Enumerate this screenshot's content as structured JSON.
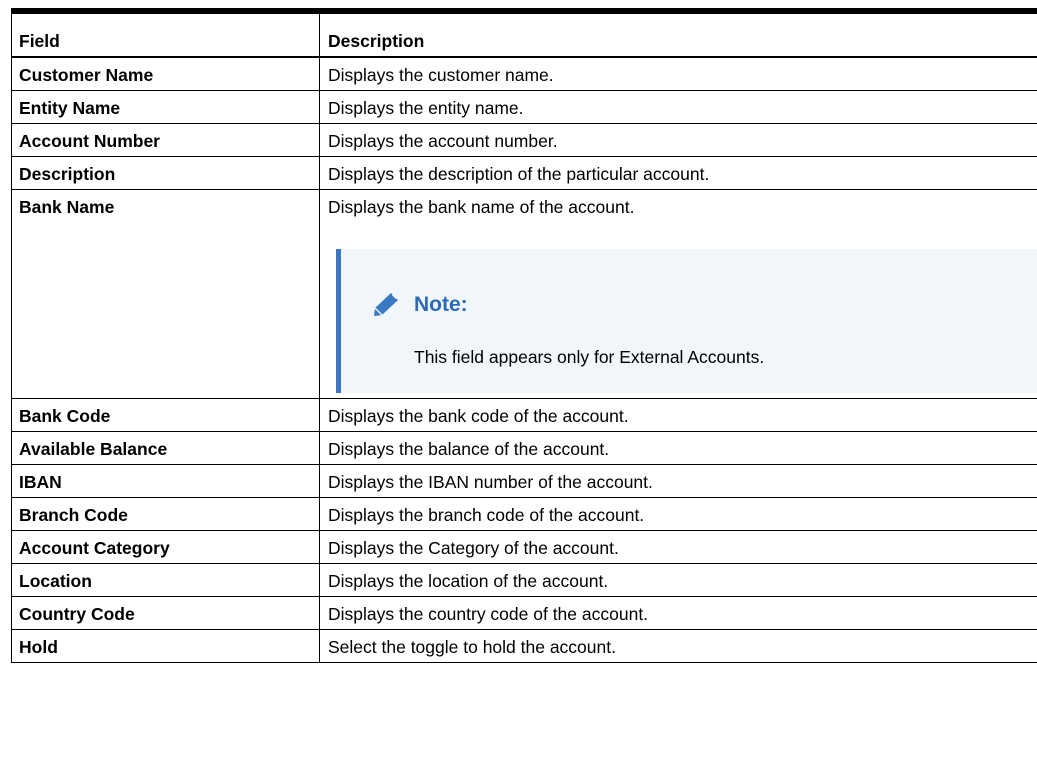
{
  "table": {
    "headers": {
      "field": "Field",
      "description": "Description"
    },
    "rows": [
      {
        "field": "Customer Name",
        "description": "Displays the customer name."
      },
      {
        "field": "Entity Name",
        "description": "Displays the entity name."
      },
      {
        "field": "Account Number",
        "description": "Displays the account number."
      },
      {
        "field": "Description",
        "description": "Displays the description of the particular account."
      },
      {
        "field": "Bank Name",
        "description": "Displays the bank name of the account."
      },
      {
        "field": "Bank Code",
        "description": "Displays the bank code of the account."
      },
      {
        "field": "Available Balance",
        "description": "Displays the balance of the account."
      },
      {
        "field": "IBAN",
        "description": "Displays the IBAN number of the account."
      },
      {
        "field": "Branch Code",
        "description": "Displays the branch code of the account."
      },
      {
        "field": "Account Category",
        "description": "Displays the Category of the account."
      },
      {
        "field": "Location",
        "description": "Displays the location of the account."
      },
      {
        "field": "Country Code",
        "description": "Displays the country code of the account."
      },
      {
        "field": "Hold",
        "description": "Select the toggle to hold the account."
      }
    ]
  },
  "note": {
    "icon": "pencil-icon",
    "title": "Note:",
    "text": "This field appears only for External Accounts.",
    "accent_color": "#3b78c4",
    "title_color": "#2c6ab6",
    "background_color": "#f1f6fb"
  }
}
